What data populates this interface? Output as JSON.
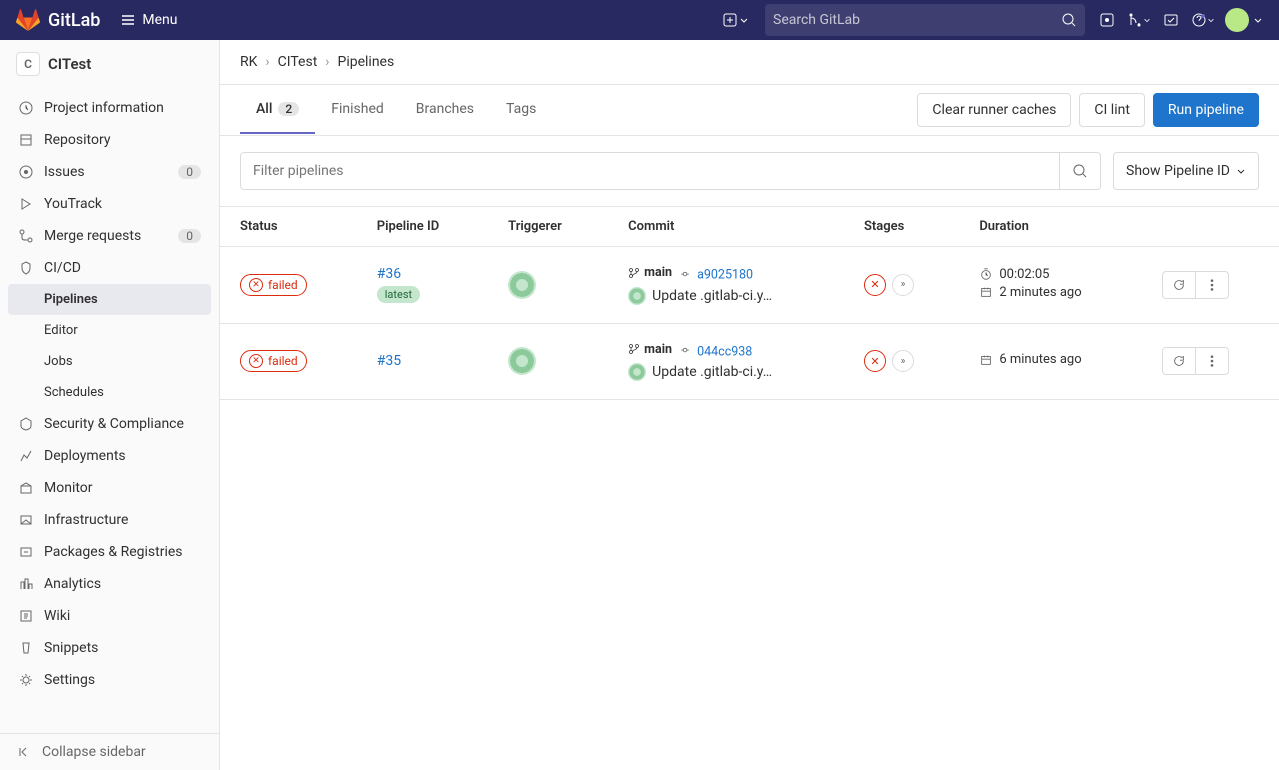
{
  "topbar": {
    "brand": "GitLab",
    "menu": "Menu",
    "search_placeholder": "Search GitLab"
  },
  "sidebar": {
    "project_letter": "C",
    "project_name": "CITest",
    "items": [
      {
        "label": "Project information"
      },
      {
        "label": "Repository"
      },
      {
        "label": "Issues",
        "badge": "0"
      },
      {
        "label": "YouTrack"
      },
      {
        "label": "Merge requests",
        "badge": "0"
      },
      {
        "label": "CI/CD"
      },
      {
        "label": "Pipelines",
        "sub": true,
        "active": true
      },
      {
        "label": "Editor",
        "sub": true
      },
      {
        "label": "Jobs",
        "sub": true
      },
      {
        "label": "Schedules",
        "sub": true
      },
      {
        "label": "Security & Compliance"
      },
      {
        "label": "Deployments"
      },
      {
        "label": "Monitor"
      },
      {
        "label": "Infrastructure"
      },
      {
        "label": "Packages & Registries"
      },
      {
        "label": "Analytics"
      },
      {
        "label": "Wiki"
      },
      {
        "label": "Snippets"
      },
      {
        "label": "Settings"
      }
    ],
    "collapse": "Collapse sidebar"
  },
  "breadcrumb": {
    "p1": "RK",
    "p2": "CITest",
    "p3": "Pipelines"
  },
  "tabs": {
    "all": "All",
    "all_count": "2",
    "finished": "Finished",
    "branches": "Branches",
    "tags": "Tags"
  },
  "buttons": {
    "clear": "Clear runner caches",
    "lint": "CI lint",
    "run": "Run pipeline"
  },
  "filter": {
    "placeholder": "Filter pipelines",
    "dropdown": "Show Pipeline ID"
  },
  "table": {
    "headers": {
      "status": "Status",
      "pipeline": "Pipeline ID",
      "triggerer": "Triggerer",
      "commit": "Commit",
      "stages": "Stages",
      "duration": "Duration"
    },
    "rows": [
      {
        "status": "failed",
        "id": "#36",
        "latest": "latest",
        "branch": "main",
        "hash": "a9025180",
        "msg": "Update .gitlab-ci.y…",
        "duration": "00:02:05",
        "finished": "2 minutes ago"
      },
      {
        "status": "failed",
        "id": "#35",
        "branch": "main",
        "hash": "044cc938",
        "msg": "Update .gitlab-ci.y…",
        "finished": "6 minutes ago"
      }
    ]
  }
}
